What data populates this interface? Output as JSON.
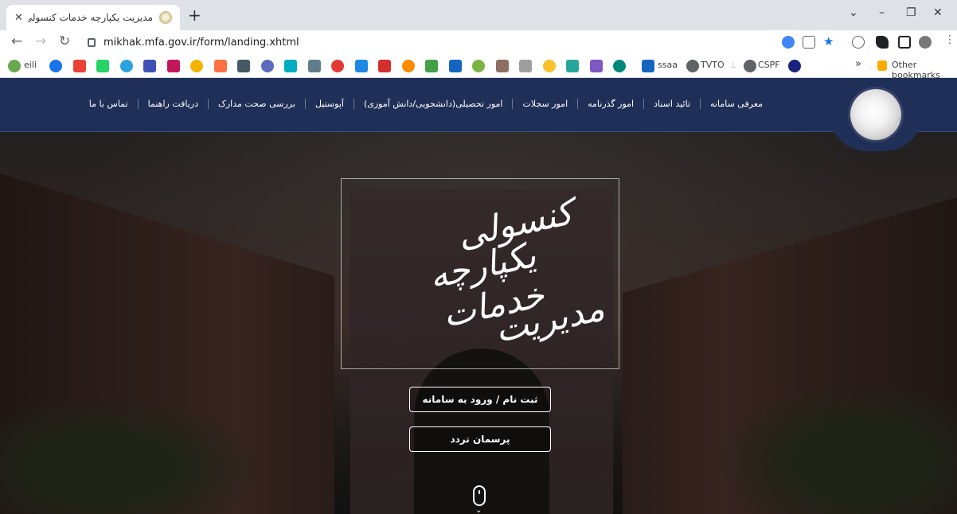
{
  "browser": {
    "tab_title": "مدیریت یکپارچه خدمات کنسولی",
    "tab_close": "✕",
    "new_tab": "+",
    "url": "mikhak.mfa.gov.ir/form/landing.xhtml",
    "window_controls": [
      "⌄",
      "–",
      "❐",
      "✕"
    ],
    "nav_icons": [
      "back-icon",
      "forward-icon",
      "reload-icon"
    ]
  },
  "bookmarks": {
    "items": [
      {
        "label": "eili",
        "color": "#6aa84f"
      },
      {
        "label": "",
        "color": "#1a73e8"
      },
      {
        "label": "",
        "color": "#ea4335"
      },
      {
        "label": "",
        "color": "#25d366"
      },
      {
        "label": "",
        "color": "#2aa3e0"
      },
      {
        "label": "",
        "color": "#3f51b5"
      },
      {
        "label": "",
        "color": "#c2185b"
      },
      {
        "label": "",
        "color": "#f4b400"
      },
      {
        "label": "",
        "color": "#ff7043"
      },
      {
        "label": "",
        "color": "#455a64"
      },
      {
        "label": "",
        "color": "#5c6bc0"
      },
      {
        "label": "",
        "color": "#00acc1"
      },
      {
        "label": "",
        "color": "#607d8b"
      },
      {
        "label": "",
        "color": "#e53935"
      },
      {
        "label": "",
        "color": "#1e88e5"
      },
      {
        "label": "",
        "color": "#d32f2f"
      },
      {
        "label": "",
        "color": "#fb8c00"
      },
      {
        "label": "",
        "color": "#43a047"
      },
      {
        "label": "",
        "color": "#1565c0"
      },
      {
        "label": "",
        "color": "#7cb342"
      },
      {
        "label": "",
        "color": "#8d6e63"
      },
      {
        "label": "",
        "color": "#9e9e9e"
      },
      {
        "label": "",
        "color": "#fbc02d"
      },
      {
        "label": "",
        "color": "#26a69a"
      },
      {
        "label": "",
        "color": "#7e57c2"
      },
      {
        "label": "",
        "color": "#00897b"
      }
    ],
    "ssaa": "ssaa",
    "tvto": "TVTO",
    "cspf": "CSPF",
    "more": "»",
    "other": "Other bookmarks"
  },
  "site": {
    "nav": [
      "معرفی سامانه",
      "تائید اسناد",
      "امور گذرنامه",
      "امور سجلات",
      "امور تحصیلی(دانشجویی/دانش آموزی)",
      "آپوستیل",
      "بررسی صحت مدارک",
      "دریافت راهنما",
      "تماس با ما"
    ],
    "calligraphy": [
      "کنسولی",
      "یکپارچه خدمات",
      "مدیریت"
    ],
    "btn_register": "ثبت نام / ورود به سامانه",
    "btn_survey": "پرسمان تردد",
    "nav_bg": "#1f2f57"
  }
}
